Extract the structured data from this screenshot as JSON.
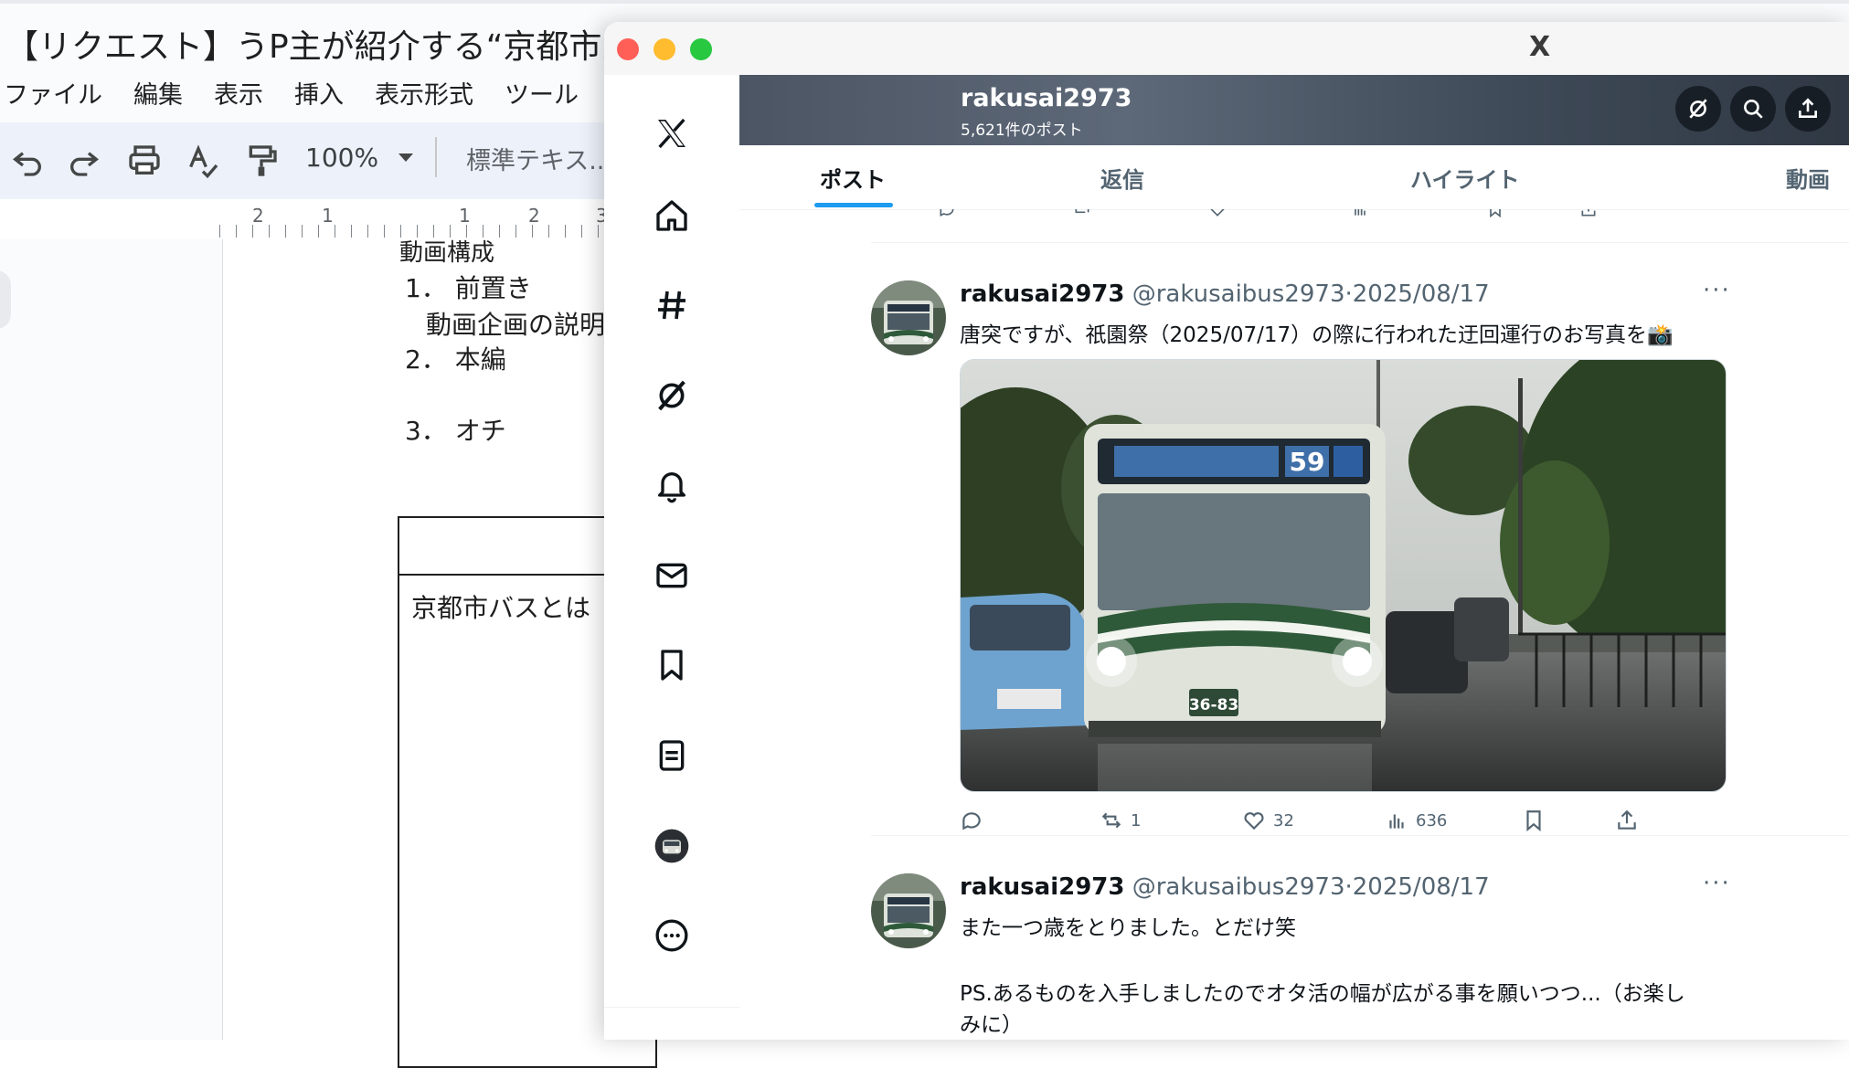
{
  "doc": {
    "title": "【リクエスト】うP主が紹介する“京都市バ",
    "menu": [
      "ファイル",
      "編集",
      "表示",
      "挿入",
      "表示形式",
      "ツール"
    ],
    "zoom": "100%",
    "style_select": "標準テキス...",
    "ruler_numbers": [
      "2",
      "1",
      "1",
      "2",
      "3"
    ],
    "body": {
      "heading": "動画構成",
      "item1": "1． 前置き",
      "item1_sub": "動画企画の説明",
      "item2": "2． 本編",
      "item3": "3． オチ",
      "box_text": "京都市バスとは"
    }
  },
  "xwindow": {
    "title": "X",
    "traffic_colors": [
      "#ff5f57",
      "#febc2e",
      "#28c840"
    ],
    "sidebar_icons": [
      "x-logo-icon",
      "home-icon",
      "explore-hash-icon",
      "grok-icon",
      "notifications-bell-icon",
      "messages-mail-icon",
      "bookmarks-icon",
      "lists-icon",
      "profile-avatar-icon",
      "more-icon"
    ],
    "profile": {
      "name": "rakusai2973",
      "post_count": "5,621件のポスト"
    },
    "tabs": [
      {
        "label": "ポスト",
        "active": true
      },
      {
        "label": "返信",
        "active": false
      },
      {
        "label": "ハイライト",
        "active": false
      },
      {
        "label": "動画",
        "active": false
      }
    ],
    "posts": [
      {
        "name": "rakusai2973",
        "handle": "@rakusaibus2973",
        "date": "·2025/08/17",
        "text": "唐突ですが、祇園祭（2025/07/17）の際に行われた迂回運行のお写真を📸",
        "media_alt": "京都市バス 59系統",
        "bus_route_number": "59",
        "plate": "36-83",
        "actions": {
          "reply": "",
          "repost": "1",
          "like": "32",
          "views": "636"
        }
      },
      {
        "name": "rakusai2973",
        "handle": "@rakusaibus2973",
        "date": "·2025/08/17",
        "text_line1": "また一つ歳をとりました。とだけ笑",
        "text_line2": "PS.あるものを入手しましたのでオタ活の幅が広がる事を願いつつ...（お楽し",
        "text_line3": "みに）"
      }
    ],
    "colors": {
      "accent": "#1d9bf0",
      "text": "#0f1419",
      "secondary": "#536471"
    }
  }
}
